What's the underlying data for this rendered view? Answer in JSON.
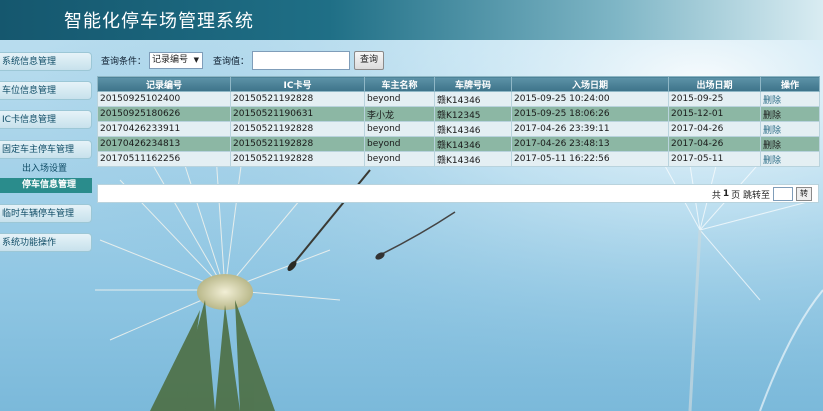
{
  "header": {
    "title": "智能化停车场管理系统"
  },
  "sidebar": {
    "items": [
      {
        "label": "系统信息管理"
      },
      {
        "label": "车位信息管理"
      },
      {
        "label": "IC卡信息管理"
      },
      {
        "label": "固定车主停车管理"
      },
      {
        "label": "临时车辆停车管理"
      },
      {
        "label": "系统功能操作"
      }
    ],
    "sub_items": [
      {
        "label": "出入场设置"
      },
      {
        "label": "停车信息管理"
      }
    ]
  },
  "query": {
    "condition_label": "查询条件：",
    "condition_value": "记录编号",
    "value_label": "查询值：",
    "value_input": "",
    "button_label": "查询"
  },
  "table": {
    "headers": [
      "记录编号",
      "IC卡号",
      "车主名称",
      "车牌号码",
      "入场日期",
      "出场日期",
      "操作"
    ],
    "rows": [
      [
        "20150925102400",
        "20150521192828",
        "beyond",
        "赣K14346",
        "2015-09-25 10:24:00",
        "2015-09-25",
        "删除"
      ],
      [
        "20150925180626",
        "20150521190631",
        "李小龙",
        "赣K12345",
        "2015-09-25 18:06:26",
        "2015-12-01",
        "删除"
      ],
      [
        "20170426233911",
        "20150521192828",
        "beyond",
        "赣K14346",
        "2017-04-26 23:39:11",
        "2017-04-26",
        "删除"
      ],
      [
        "20170426234813",
        "20150521192828",
        "beyond",
        "赣K14346",
        "2017-04-26 23:48:13",
        "2017-04-26",
        "删除"
      ],
      [
        "20170511162256",
        "20150521192828",
        "beyond",
        "赣K14346",
        "2017-05-11 16:22:56",
        "2017-05-11",
        "删除"
      ]
    ]
  },
  "pager": {
    "prefix": "共",
    "total": "1",
    "suffix": "页 跳转至",
    "input": "",
    "button_label": "转"
  }
}
